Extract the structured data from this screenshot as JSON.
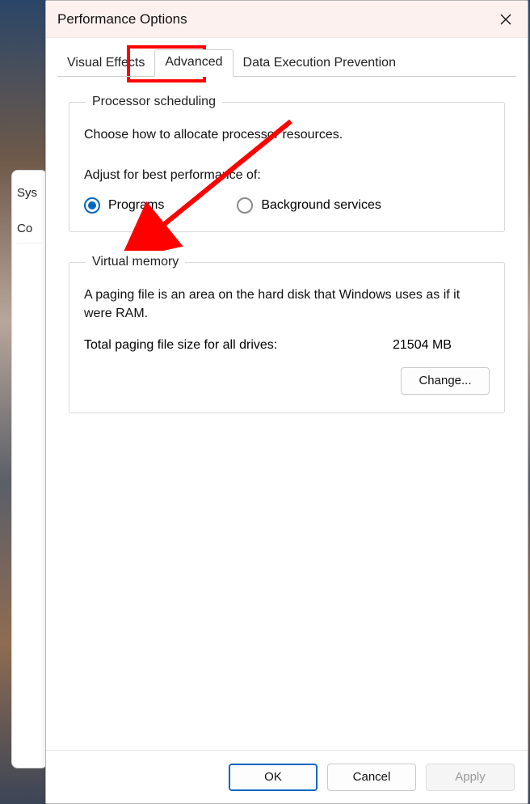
{
  "window": {
    "title": "Performance Options",
    "close_icon": "close-icon"
  },
  "tabs": [
    {
      "label": "Visual Effects",
      "active": false
    },
    {
      "label": "Advanced",
      "active": true
    },
    {
      "label": "Data Execution Prevention",
      "active": false
    }
  ],
  "processor_scheduling": {
    "legend": "Processor scheduling",
    "description": "Choose how to allocate processor resources.",
    "subhead": "Adjust for best performance of:",
    "options": {
      "programs": {
        "label": "Programs",
        "checked": true
      },
      "background": {
        "label": "Background services",
        "checked": false
      }
    }
  },
  "virtual_memory": {
    "legend": "Virtual memory",
    "description": "A paging file is an area on the hard disk that Windows uses as if it were RAM.",
    "total_label": "Total paging file size for all drives:",
    "total_value": "21504 MB",
    "change_label": "Change..."
  },
  "footer": {
    "ok": "OK",
    "cancel": "Cancel",
    "apply": "Apply"
  },
  "background_window": {
    "row1": "Sys",
    "row2": "Co"
  },
  "annotation": {
    "highlight": "red-box",
    "arrow_color": "#ff0000"
  }
}
